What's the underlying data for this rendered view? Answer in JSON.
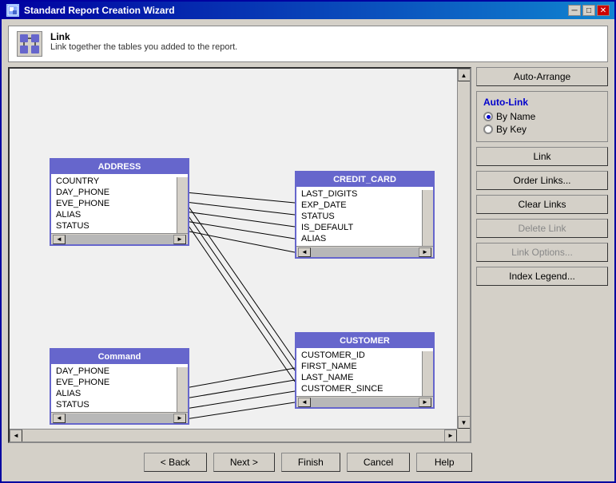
{
  "window": {
    "title": "Standard Report Creation Wizard",
    "icon": "wizard-icon"
  },
  "header": {
    "section_title": "Link",
    "description": "Link together the tables you added to the report."
  },
  "right_panel": {
    "auto_arrange_label": "Auto-Arrange",
    "auto_link_title": "Auto-Link",
    "by_name_label": "By Name",
    "by_key_label": "By Key",
    "link_label": "Link",
    "order_links_label": "Order Links...",
    "clear_links_label": "Clear Links",
    "delete_link_label": "Delete Link",
    "link_options_label": "Link Options...",
    "index_legend_label": "Index Legend..."
  },
  "tables": {
    "address": {
      "name": "ADDRESS",
      "fields": [
        "COUNTRY",
        "DAY_PHONE",
        "EVE_PHONE",
        "ALIAS",
        "STATUS"
      ]
    },
    "credit_card": {
      "name": "CREDIT_CARD",
      "fields": [
        "LAST_DIGITS",
        "EXP_DATE",
        "STATUS",
        "IS_DEFAULT",
        "ALIAS"
      ]
    },
    "command": {
      "name": "Command",
      "fields": [
        "DAY_PHONE",
        "EVE_PHONE",
        "ALIAS",
        "STATUS"
      ]
    },
    "customer": {
      "name": "CUSTOMER",
      "fields": [
        "CUSTOMER_ID",
        "FIRST_NAME",
        "LAST_NAME",
        "CUSTOMER_SINCE"
      ]
    }
  },
  "footer": {
    "back_label": "< Back",
    "next_label": "Next >",
    "finish_label": "Finish",
    "cancel_label": "Cancel",
    "help_label": "Help"
  }
}
